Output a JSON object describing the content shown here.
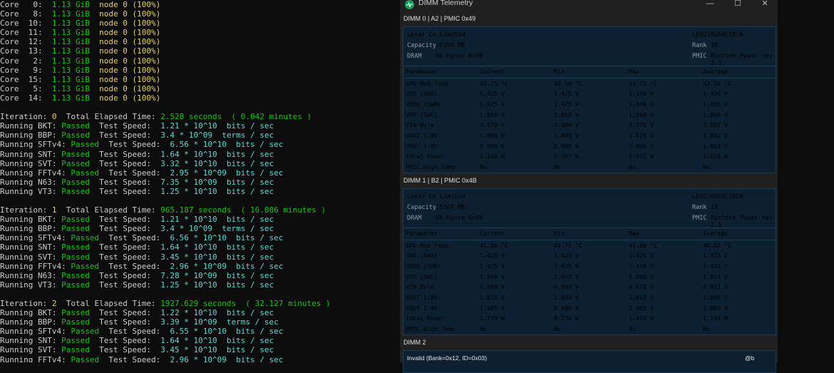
{
  "terminal": {
    "cores": [
      {
        "id": "Core   0:",
        "mem": "1.13 GiB",
        "node": "node 0 (100%)"
      },
      {
        "id": "Core   8:",
        "mem": "1.13 GiB",
        "node": "node 0 (100%)"
      },
      {
        "id": "Core  10:",
        "mem": "1.13 GiB",
        "node": "node 0 (100%)"
      },
      {
        "id": "Core  11:",
        "mem": "1.13 GiB",
        "node": "node 0 (100%)"
      },
      {
        "id": "Core  12:",
        "mem": "1.13 GiB",
        "node": "node 0 (100%)"
      },
      {
        "id": "Core  13:",
        "mem": "1.13 GiB",
        "node": "node 0 (100%)"
      },
      {
        "id": "Core   2:",
        "mem": "1.13 GiB",
        "node": "node 0 (100%)"
      },
      {
        "id": "Core   9:",
        "mem": "1.13 GiB",
        "node": "node 0 (100%)"
      },
      {
        "id": "Core  15:",
        "mem": "1.13 GiB",
        "node": "node 0 (100%)"
      },
      {
        "id": "Core   5:",
        "mem": "1.13 GiB",
        "node": "node 0 (100%)"
      },
      {
        "id": "Core  14:",
        "mem": "1.13 GiB",
        "node": "node 0 (100%)"
      }
    ],
    "iterations": [
      {
        "label": "Iteration: ",
        "num": "0",
        "mid": "  Total Elapsed Time: ",
        "time": "2.528 seconds  ( 0.042 minutes )",
        "tests": [
          {
            "name": "Running BKT: ",
            "status": "Passed",
            "pad": "  ",
            "ts": "Test Speed:  ",
            "val": "1.21 * 10^10  bits / sec"
          },
          {
            "name": "Running BBP: ",
            "status": "Passed",
            "pad": "  ",
            "ts": "Test Speed:  ",
            "val": "3.4 * 10^09  terms / sec"
          },
          {
            "name": "Running SFTv4: ",
            "status": "Passed",
            "pad": "  ",
            "ts": "Test Speed:  ",
            "val": "6.56 * 10^10  bits / sec"
          },
          {
            "name": "Running SNT: ",
            "status": "Passed",
            "pad": "  ",
            "ts": "Test Speed:  ",
            "val": "1.64 * 10^10  bits / sec"
          },
          {
            "name": "Running SVT: ",
            "status": "Passed",
            "pad": "  ",
            "ts": "Test Speed:  ",
            "val": "3.32 * 10^10  bits / sec"
          },
          {
            "name": "Running FFTv4: ",
            "status": "Passed",
            "pad": "  ",
            "ts": "Test Speed:  ",
            "val": "2.95 * 10^09  bits / sec"
          },
          {
            "name": "Running N63: ",
            "status": "Passed",
            "pad": "  ",
            "ts": "Test Speed:  ",
            "val": "7.35 * 10^09  bits / sec"
          },
          {
            "name": "Running VT3: ",
            "status": "Passed",
            "pad": "  ",
            "ts": "Test Speed:  ",
            "val": "1.25 * 10^10  bits / sec"
          }
        ]
      },
      {
        "label": "Iteration: ",
        "num": "1",
        "mid": "  Total Elapsed Time: ",
        "time": "965.187 seconds  ( 16.086 minutes )",
        "tests": [
          {
            "name": "Running BKT: ",
            "status": "Passed",
            "pad": "  ",
            "ts": "Test Speed:  ",
            "val": "1.21 * 10^10  bits / sec"
          },
          {
            "name": "Running BBP: ",
            "status": "Passed",
            "pad": "  ",
            "ts": "Test Speed:  ",
            "val": "3.4 * 10^09  terms / sec"
          },
          {
            "name": "Running SFTv4: ",
            "status": "Passed",
            "pad": "  ",
            "ts": "Test Speed:  ",
            "val": "6.56 * 10^10  bits / sec"
          },
          {
            "name": "Running SNT: ",
            "status": "Passed",
            "pad": "  ",
            "ts": "Test Speed:  ",
            "val": "1.64 * 10^10  bits / sec"
          },
          {
            "name": "Running SVT: ",
            "status": "Passed",
            "pad": "  ",
            "ts": "Test Speed:  ",
            "val": "3.45 * 10^10  bits / sec"
          },
          {
            "name": "Running FFTv4: ",
            "status": "Passed",
            "pad": "  ",
            "ts": "Test Speed:  ",
            "val": "2.96 * 10^09  bits / sec"
          },
          {
            "name": "Running N63: ",
            "status": "Passed",
            "pad": "  ",
            "ts": "Test Speed:  ",
            "val": "7.28 * 10^09  bits / sec"
          },
          {
            "name": "Running VT3: ",
            "status": "Passed",
            "pad": "  ",
            "ts": "Test Speed:  ",
            "val": "1.25 * 10^10  bits / sec"
          }
        ]
      },
      {
        "label": "Iteration: ",
        "num": "2",
        "mid": "  Total Elapsed Time: ",
        "time": "1927.629 seconds  ( 32.127 minutes )",
        "tests": [
          {
            "name": "Running BKT: ",
            "status": "Passed",
            "pad": "  ",
            "ts": "Test Speed:  ",
            "val": "1.22 * 10^10  bits / sec"
          },
          {
            "name": "Running BBP: ",
            "status": "Passed",
            "pad": "  ",
            "ts": "Test Speed:  ",
            "val": "3.39 * 10^09  terms / sec"
          },
          {
            "name": "Running SFTv4: ",
            "status": "Passed",
            "pad": "  ",
            "ts": "Test Speed:  ",
            "val": "6.55 * 10^10  bits / sec"
          },
          {
            "name": "Running SNT: ",
            "status": "Passed",
            "pad": "  ",
            "ts": "Test Speed:  ",
            "val": "1.64 * 10^10  bits / sec"
          },
          {
            "name": "Running SVT: ",
            "status": "Passed",
            "pad": "  ",
            "ts": "Test Speed:  ",
            "val": "3.45 * 10^10  bits / sec"
          },
          {
            "name": "Running FFTv4: ",
            "status": "Passed",
            "pad": "  ",
            "ts": "Test Speed:  ",
            "val": "2.96 * 10^09  bits / sec"
          }
        ]
      }
    ]
  },
  "window": {
    "title": "DIMM Telemetry",
    "minimize": "—",
    "maximize": "☐",
    "close": "✕",
    "columns": [
      "Parameter",
      "Current",
      "Min",
      "Max",
      "Average"
    ],
    "dimms": [
      {
        "header": "DIMM 0 | A2 | PMIC 0x49",
        "manufacturer": "Lexar Co Limited",
        "part": "LD5U16G60C28LW",
        "capacity_label": "Capacity",
        "capacity": "16384 MB",
        "rank_label": "Rank",
        "rank": "1R",
        "dram_label": "DRAM",
        "dram": "SK Hynix 0x00",
        "pmic_label": "PMIC",
        "pmic": "Richtek Power rev 2.1",
        "rows": [
          [
            "SPD Hub Temp",
            "43.75 °C",
            "43.50 °C",
            "43.75 °C",
            "43.56 °C"
          ],
          [
            "VDD (SWA)",
            "1.425 V",
            "1.425 V",
            "1.440 V",
            "1.426 V"
          ],
          [
            "VDDQ (SWB)",
            "1.425 V",
            "1.425 V",
            "1.440 V",
            "1.436 V"
          ],
          [
            "VPP (SWC)",
            "1.860 V",
            "1.860 V",
            "1.860 V",
            "1.860 V"
          ],
          [
            "VIN Bulk",
            "4.970 V",
            "4.900 V",
            "4.970 V",
            "4.957 V"
          ],
          [
            "VOUT 1.8V",
            "1.800 V",
            "1.800 V",
            "1.815 V",
            "1.802 V"
          ],
          [
            "VOUT 1.0V",
            "0.990 V",
            "0.990 V",
            "1.005 V",
            "1.003 V"
          ],
          [
            "Total Power",
            "1.108 W",
            "0.367 W",
            "1.552 W",
            "1.169 W"
          ],
          [
            "PMIC High Temp",
            "No",
            "No",
            "No",
            "No"
          ]
        ]
      },
      {
        "header": "DIMM 1 | B2 | PMIC 0x4B",
        "manufacturer": "Lexar Co Limited",
        "part": "LD5U16G60C28LW",
        "capacity_label": "Capacity",
        "capacity": "16384 MB",
        "rank_label": "Rank",
        "rank": "1R",
        "dram_label": "DRAM",
        "dram": "SK Hynix 0x00",
        "pmic_label": "PMIC",
        "pmic": "Richtek Power rev 2.1",
        "rows": [
          [
            "SPD Hub Temp",
            "41.00 °C",
            "40.75 °C",
            "41.00 °C",
            "40.83 °C"
          ],
          [
            "VDD (SWA)",
            "1.425 V",
            "1.425 V",
            "1.425 V",
            "1.425 V"
          ],
          [
            "VDDQ (SWB)",
            "1.425 V",
            "1.425 V",
            "1.440 V",
            "1.431 V"
          ],
          [
            "VPP (SWC)",
            "1.860 V",
            "1.845 V",
            "1.860 V",
            "1.853 V"
          ],
          [
            "VIN Bulk",
            "4.900 V",
            "4.900 V",
            "4.970 V",
            "4.921 V"
          ],
          [
            "VOUT 1.8V",
            "1.815 V",
            "1.800 V",
            "1.815 V",
            "1.809 V"
          ],
          [
            "VOUT 1.0V",
            "1.005 V",
            "0.990 V",
            "1.005 V",
            "1.003 V"
          ],
          [
            "Total Power",
            "1.239 W",
            "0.234 W",
            "1.472 W",
            "1.134 W"
          ],
          [
            "PMIC High Temp",
            "No",
            "No",
            "No",
            "No"
          ]
        ]
      }
    ],
    "dimm2": {
      "header": "DIMM 2",
      "message": "Invalid (Bank=0x12, ID=0x03)",
      "tag": "@b"
    }
  }
}
